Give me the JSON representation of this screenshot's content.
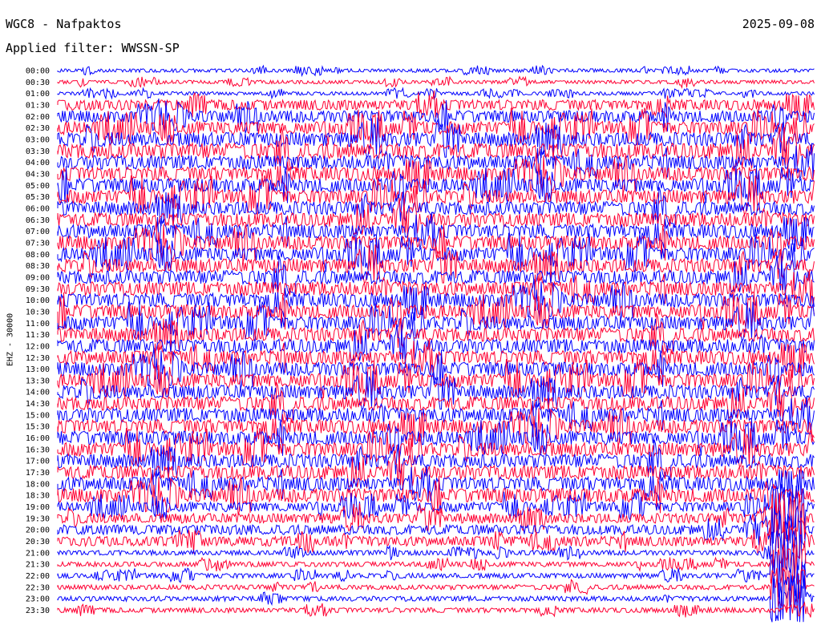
{
  "header": {
    "station": "WGC8 - Nafpaktos",
    "date": "2025-09-08",
    "filter": "Applied filter: WWSSN-SP"
  },
  "chart_data": {
    "type": "line",
    "chart_kind": "helicorder",
    "ylabel": "EHZ - 30000",
    "series": [
      {
        "values": [
          "00:00",
          "00:30",
          "01:00",
          "01:30",
          "02:00",
          "02:30",
          "03:00",
          "03:30",
          "04:00",
          "04:30",
          "05:00",
          "05:30",
          "06:00",
          "06:30",
          "07:00",
          "07:30",
          "08:00",
          "08:30",
          "09:00",
          "09:30",
          "10:00",
          "10:30",
          "11:00",
          "11:30",
          "12:00",
          "12:30",
          "13:00",
          "13:30",
          "14:00",
          "14:30",
          "15:00",
          "15:30",
          "16:00",
          "16:30",
          "17:00",
          "17:30",
          "18:00",
          "18:30",
          "19:00",
          "19:30",
          "20:00",
          "20:30",
          "21:00",
          "21:30",
          "22:00",
          "22:30",
          "23:00",
          "23:30"
        ]
      }
    ],
    "colors": [
      "#0000ff",
      "#ff0033"
    ],
    "grid": false,
    "legend": "none"
  }
}
